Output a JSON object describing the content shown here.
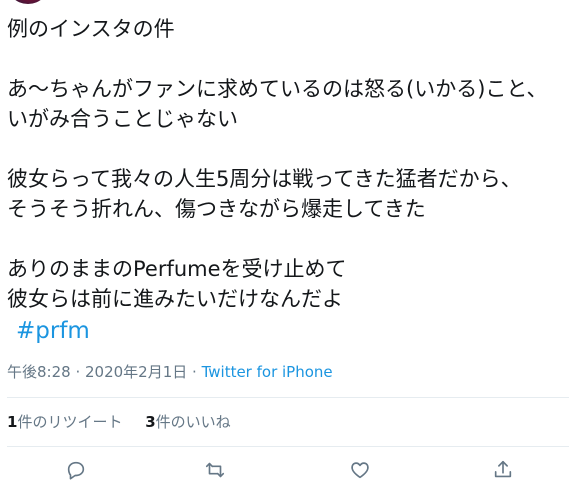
{
  "tweet": {
    "lines": [
      "例のインスタの件",
      "",
      "あ〜ちゃんがファンに求めているのは怒る(いかる)こと、",
      "いがみ合うことじゃない",
      "",
      "彼女らって我々の人生5周分は戦ってきた猛者だから、",
      "そうそう折れん、傷つきながら爆走してきた",
      "",
      "ありのままのPerfumeを受け止めて",
      "彼女らは前に進みたいだけなんだよ"
    ],
    "hashtag": "#prfm"
  },
  "meta": {
    "time": "午後8:28",
    "separator1": " · ",
    "date": "2020年2月1日",
    "separator2": " · ",
    "source": "Twitter for iPhone"
  },
  "stats": {
    "retweet_count": "1",
    "retweet_label": "件のリツイート",
    "like_count": "3",
    "like_label": "件のいいね"
  },
  "actions": {
    "reply_icon": "reply-icon",
    "retweet_icon": "retweet-icon",
    "like_icon": "heart-icon",
    "share_icon": "share-icon"
  }
}
